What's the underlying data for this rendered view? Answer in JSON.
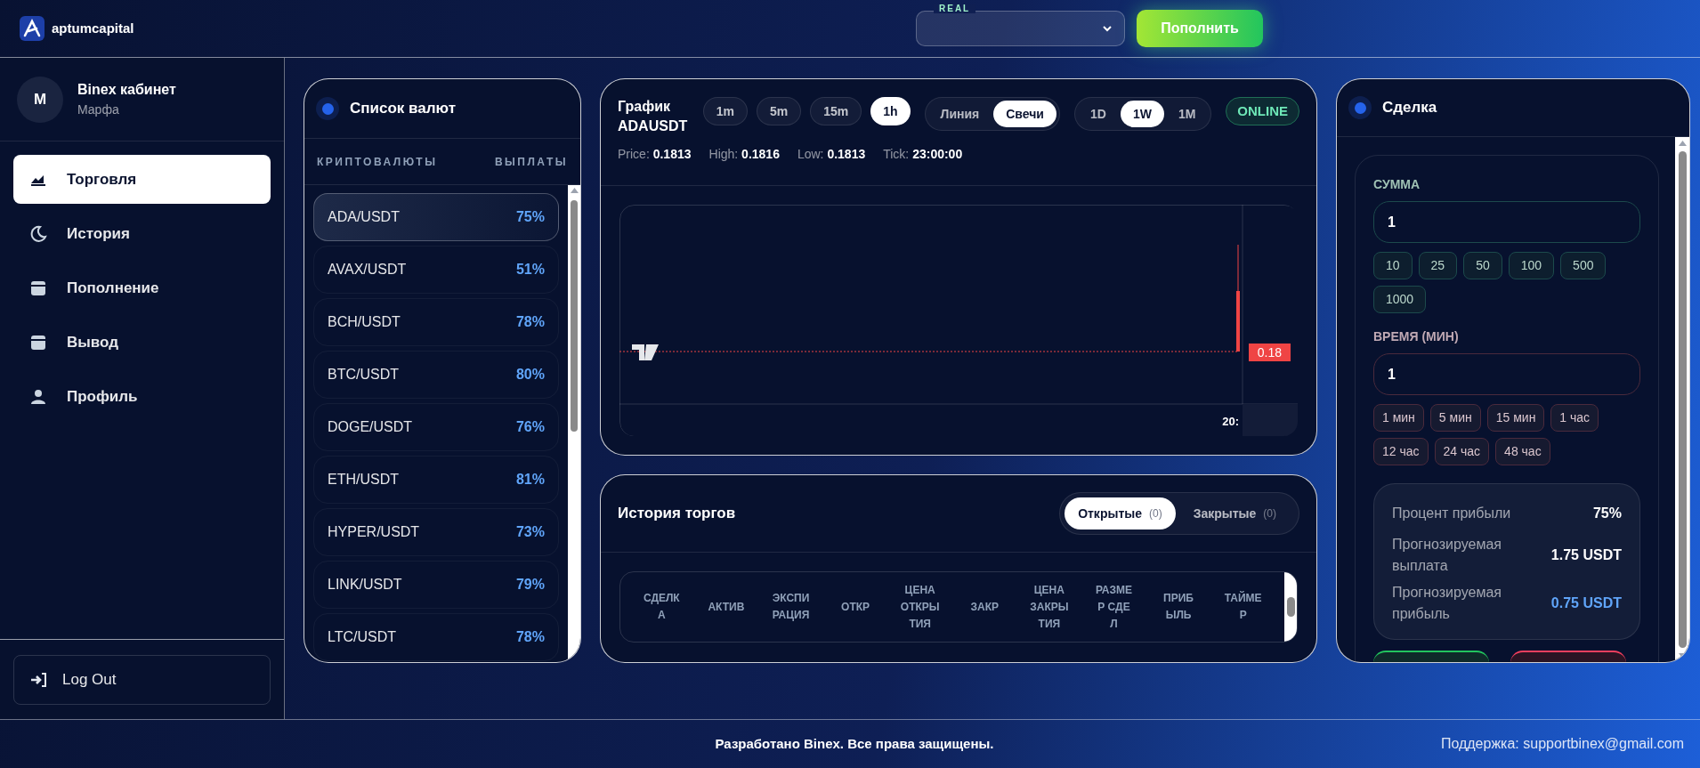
{
  "header": {
    "logo_text": "aptumcapital",
    "account_badge": "REAL",
    "deposit_button": "Пополнить"
  },
  "sidebar": {
    "user": {
      "avatar_letter": "M",
      "name": "Binex кабинет",
      "subtitle": "Марфа"
    },
    "nav": [
      {
        "label": "Торговля",
        "selected": true
      },
      {
        "label": "История",
        "selected": false
      },
      {
        "label": "Пополнение",
        "selected": false
      },
      {
        "label": "Вывод",
        "selected": false
      },
      {
        "label": "Профиль",
        "selected": false
      }
    ],
    "logout": "Log Out"
  },
  "currency_panel": {
    "title": "Список валют",
    "columns": [
      "КРИПТОВАЛЮТЫ",
      "ВЫПЛАТЫ"
    ],
    "rows": [
      {
        "pair": "ADA/USDT",
        "payout": "75%",
        "selected": true
      },
      {
        "pair": "AVAX/USDT",
        "payout": "51%",
        "selected": false
      },
      {
        "pair": "BCH/USDT",
        "payout": "78%",
        "selected": false
      },
      {
        "pair": "BTC/USDT",
        "payout": "80%",
        "selected": false
      },
      {
        "pair": "DOGE/USDT",
        "payout": "76%",
        "selected": false
      },
      {
        "pair": "ETH/USDT",
        "payout": "81%",
        "selected": false
      },
      {
        "pair": "HYPER/USDT",
        "payout": "73%",
        "selected": false
      },
      {
        "pair": "LINK/USDT",
        "payout": "79%",
        "selected": false
      },
      {
        "pair": "LTC/USDT",
        "payout": "78%",
        "selected": false
      }
    ]
  },
  "chart_panel": {
    "title": "График",
    "symbol": "ADAUSDT",
    "intervals": [
      {
        "label": "1m",
        "selected": false
      },
      {
        "label": "5m",
        "selected": false
      },
      {
        "label": "15m",
        "selected": false
      },
      {
        "label": "1h",
        "selected": true
      }
    ],
    "chart_types": [
      {
        "label": "Линия",
        "selected": false
      },
      {
        "label": "Свечи",
        "selected": true
      }
    ],
    "ranges": [
      {
        "label": "1D",
        "selected": false
      },
      {
        "label": "1W",
        "selected": true
      },
      {
        "label": "1M",
        "selected": false
      }
    ],
    "status": "ONLINE",
    "stats": [
      {
        "label": "Price:",
        "value": "0.1813"
      },
      {
        "label": "High:",
        "value": "0.1816"
      },
      {
        "label": "Low:",
        "value": "0.1813"
      },
      {
        "label": "Tick:",
        "value": "23:00:00"
      }
    ],
    "price_label": "0.18",
    "time_label": "20:"
  },
  "history_panel": {
    "title": "История торгов",
    "tabs": [
      {
        "label": "Открытые",
        "count": "(0)",
        "selected": true
      },
      {
        "label": "Закрытые",
        "count": "(0)",
        "selected": false
      }
    ],
    "columns": [
      "СДЕЛКА",
      "АКТИВ",
      "ЭКСПИРАЦИЯ",
      "ОТКР",
      "ЦЕНА ОТКРЫТИЯ",
      "ЗАКР",
      "ЦЕНА ЗАКРЫТИЯ",
      "РАЗМЕР СДЕЛ",
      "ПРИБЫЛЬ",
      "ТАЙМЕР"
    ]
  },
  "trade_panel": {
    "title": "Сделка",
    "amount_label": "СУММА",
    "amount_value": "1",
    "amount_presets": [
      "10",
      "25",
      "50",
      "100",
      "500",
      "1000"
    ],
    "time_label": "ВРЕМЯ (МИН)",
    "time_value": "1",
    "time_presets": [
      "1 мин",
      "5 мин",
      "15 мин",
      "1 час",
      "12 час",
      "24 час",
      "48 час"
    ],
    "summary": [
      {
        "label": "Процент прибыли",
        "value": "75%",
        "highlight": false
      },
      {
        "label": "Прогнозируемая выплата",
        "value": "1.75 USDT",
        "highlight": false
      },
      {
        "label": "Прогнозируемая прибыль",
        "value": "0.75 USDT",
        "highlight": true
      }
    ]
  },
  "footer": {
    "copyright": "Разработано Binex. Все права защищены.",
    "support": "Поддержка: supportbinex@gmail.com"
  }
}
